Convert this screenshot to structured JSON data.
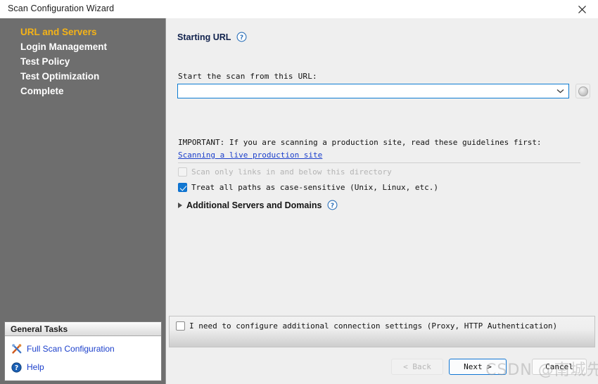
{
  "window": {
    "title": "Scan Configuration Wizard",
    "close_icon": "close-icon"
  },
  "sidebar": {
    "items": [
      {
        "label": "URL and Servers",
        "active": true
      },
      {
        "label": "Login Management",
        "active": false
      },
      {
        "label": "Test Policy",
        "active": false
      },
      {
        "label": "Test Optimization",
        "active": false
      },
      {
        "label": "Complete",
        "active": false
      }
    ],
    "active_color": "#f5b317",
    "background_color": "#6e6e6e",
    "general_tasks": {
      "header": "General Tasks",
      "items": [
        {
          "label": "Full Scan Configuration",
          "icon": "tools-icon"
        },
        {
          "label": "Help",
          "icon": "help-circle-icon"
        }
      ],
      "link_color": "#1b3fcb"
    }
  },
  "main": {
    "section_title": "Starting URL",
    "section_help_icon": "help-circle-icon",
    "url_field_label": "Start the scan from this URL:",
    "url_value": "",
    "url_placeholder": "",
    "combo_arrow_icon": "chevron-down-icon",
    "globe_button_icon": "globe-icon",
    "important_text": "IMPORTANT: If you are scanning a production site, read these guidelines first:",
    "guideline_link": "Scanning a live production site",
    "checkboxes": [
      {
        "label": "Scan only links in and below this directory",
        "checked": false,
        "disabled": true,
        "mnemonic": "l"
      },
      {
        "label": "Treat all paths as case-sensitive (Unix, Linux, etc.)",
        "checked": true,
        "disabled": false,
        "mnemonic": "T"
      }
    ],
    "expander": {
      "label": "Additional Servers and Domains",
      "expanded": false,
      "arrow_icon": "triangle-right-icon",
      "help_icon": "help-circle-icon"
    }
  },
  "option_strip": {
    "checkbox_label": "I need to configure additional connection settings (Proxy, HTTP Authentication)",
    "checked": false
  },
  "footer": {
    "back_label": "< Back",
    "next_label": "Next >",
    "cancel_label": "Cancel",
    "back_disabled": true,
    "next_is_default": true,
    "accent_color": "#1176d3"
  },
  "watermark": {
    "text": "CSDN @南城先生"
  }
}
